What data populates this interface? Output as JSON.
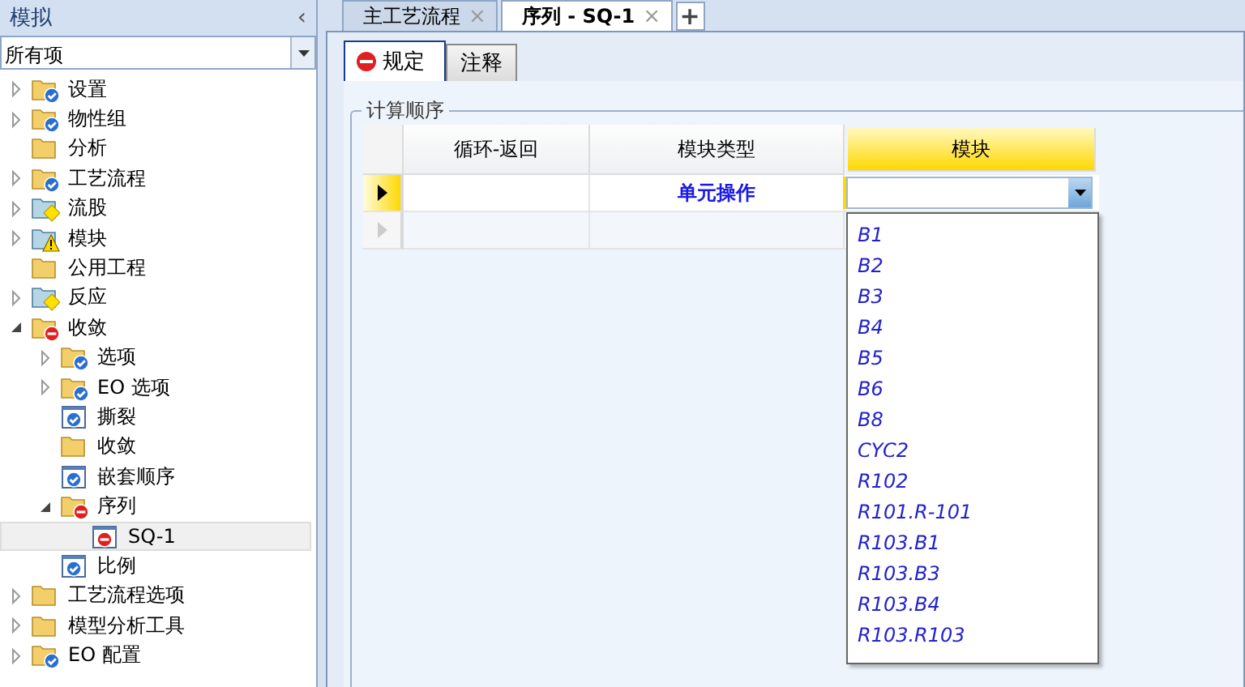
{
  "sidebar": {
    "title": "模拟",
    "collapse_glyph": "‹",
    "filter": {
      "value": "所有项"
    },
    "tree": [
      {
        "label": "设置",
        "kind": "checkfolder",
        "expanded": false
      },
      {
        "label": "物性组",
        "kind": "checkfolder",
        "expanded": false
      },
      {
        "label": "分析",
        "kind": "folder"
      },
      {
        "label": "工艺流程",
        "kind": "checkfolder",
        "expanded": false
      },
      {
        "label": "流股",
        "kind": "diamondfolder",
        "expanded": false
      },
      {
        "label": "模块",
        "kind": "warnfolder",
        "expanded": false
      },
      {
        "label": "公用工程",
        "kind": "folder"
      },
      {
        "label": "反应",
        "kind": "diamondfolder",
        "expanded": false
      },
      {
        "label": "收敛",
        "kind": "stopfolder",
        "expanded": true,
        "children": [
          {
            "label": "选项",
            "kind": "checkfolder",
            "expanded": false
          },
          {
            "label": "EO 选项",
            "kind": "checkfolder",
            "expanded": false
          },
          {
            "label": "撕裂",
            "kind": "checkform"
          },
          {
            "label": "收敛",
            "kind": "folder"
          },
          {
            "label": "嵌套顺序",
            "kind": "checkform"
          },
          {
            "label": "序列",
            "kind": "stopfolder",
            "expanded": true,
            "children": [
              {
                "label": "SQ-1",
                "kind": "stopform",
                "selected": true
              }
            ]
          },
          {
            "label": "比例",
            "kind": "checkform"
          }
        ]
      },
      {
        "label": "工艺流程选项",
        "kind": "folder",
        "expanded": false
      },
      {
        "label": "模型分析工具",
        "kind": "folder",
        "expanded": false
      },
      {
        "label": "EO 配置",
        "kind": "checkfolder",
        "expanded": false
      }
    ]
  },
  "doc_tabs": [
    {
      "label": "主工艺流程",
      "selected": false
    },
    {
      "label": "序列 - SQ-1",
      "selected": true
    }
  ],
  "doc_tab_close": "×",
  "new_tab_glyph": "+",
  "form_tabs": [
    {
      "label": "规定",
      "kind": "stop",
      "selected": true
    },
    {
      "label": "注释",
      "kind": "plain",
      "selected": false
    }
  ],
  "group": {
    "title": "计算顺序",
    "columns": [
      {
        "label": "循环-返回",
        "selected": false
      },
      {
        "label": "模块类型",
        "selected": false
      },
      {
        "label": "模块",
        "selected": true
      }
    ],
    "rows": [
      {
        "current": true,
        "cells": [
          "",
          "单元操作"
        ]
      },
      {
        "current": false,
        "cells": [
          "",
          ""
        ]
      }
    ],
    "dropdown": {
      "expanded": true,
      "options": [
        "B1",
        "B2",
        "B3",
        "B4",
        "B5",
        "B6",
        "B8",
        "CYC2",
        "R102",
        "R101.R-101",
        "R103.B1",
        "R103.B3",
        "R103.B4",
        "R103.R103"
      ]
    }
  }
}
